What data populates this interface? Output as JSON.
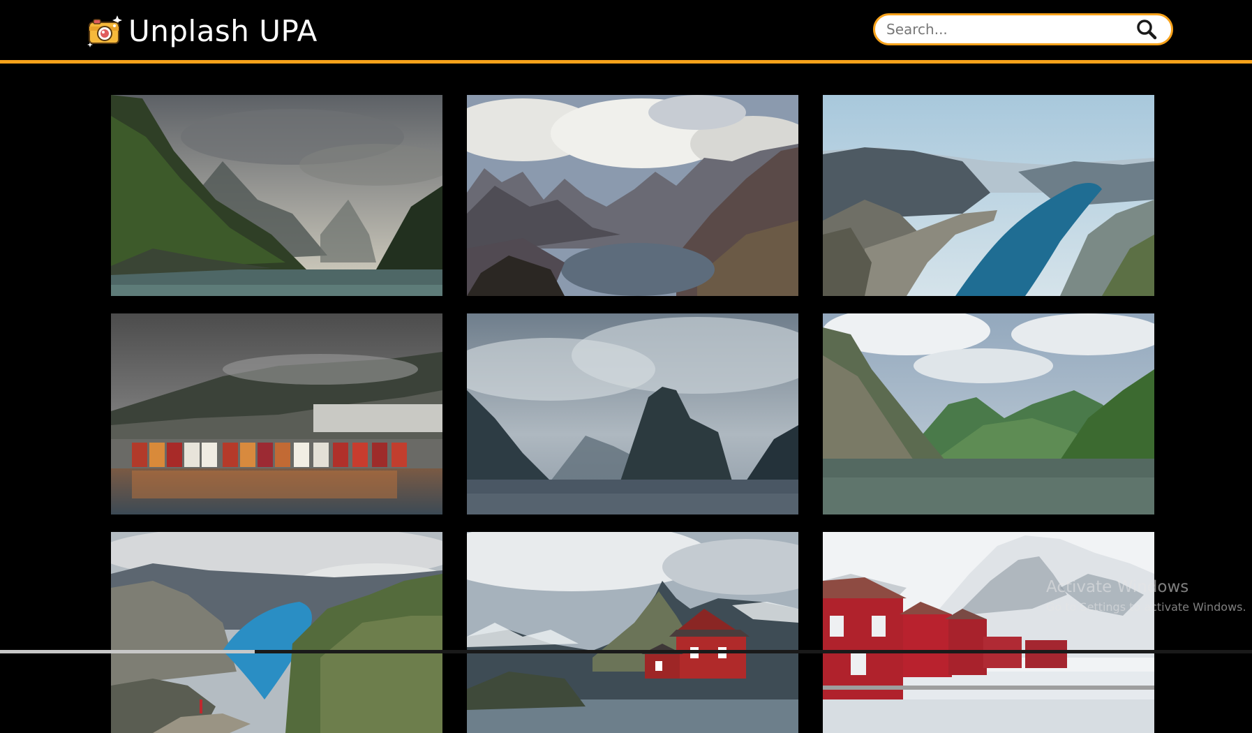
{
  "app": {
    "title": "Unplash UPA",
    "logo_icon": "camera-icon"
  },
  "search": {
    "placeholder": "Search...",
    "value": "",
    "icon": "search-icon"
  },
  "colors": {
    "background": "#000000",
    "accent": "#f7a21b",
    "header_text": "#ffffff"
  },
  "gallery": {
    "photos": [
      {
        "subject": "stormy fjord with green cliffs"
      },
      {
        "subject": "jagged mountains around lake under clouds"
      },
      {
        "subject": "rock ledge over blue fjord"
      },
      {
        "subject": "colorful harbour houses below misty hills"
      },
      {
        "subject": "misty fjord with dark peak"
      },
      {
        "subject": "green fjord valley with calm water"
      },
      {
        "subject": "hiker above turquoise lake"
      },
      {
        "subject": "red cabin below rocky peak"
      },
      {
        "subject": "red houses beneath snowy mountain"
      }
    ]
  },
  "os_watermark": {
    "line1": "Activate Windows",
    "line2": "Go to Settings to activate Windows."
  }
}
